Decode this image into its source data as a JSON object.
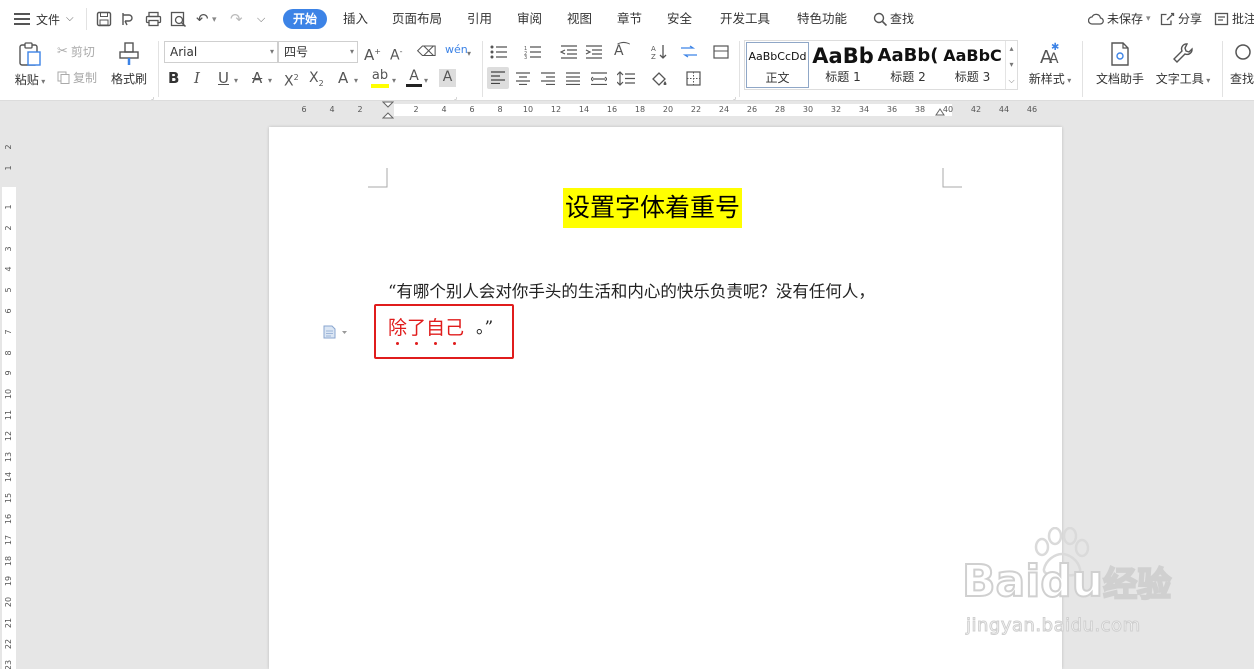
{
  "menu": {
    "file_label": "文件",
    "tabs": [
      "开始",
      "插入",
      "页面布局",
      "引用",
      "审阅",
      "视图",
      "章节",
      "安全",
      "开发工具",
      "特色功能"
    ],
    "search_label": "查找",
    "unsaved_label": "未保存",
    "share_label": "分享",
    "comment_label": "批注"
  },
  "ribbon": {
    "paste_label": "粘贴",
    "cut_label": "剪切",
    "copy_label": "复制",
    "format_painter_label": "格式刷",
    "font_name": "Arial",
    "font_size": "四号",
    "styles": [
      {
        "sample": "AaBbCcDd",
        "name": "正文"
      },
      {
        "sample": "AaBb",
        "name": "标题 1"
      },
      {
        "sample": "AaBb(",
        "name": "标题 2"
      },
      {
        "sample": "AaBbC",
        "name": "标题 3"
      }
    ],
    "new_style_label": "新样式",
    "doc_helper_label": "文档助手",
    "text_tools_label": "文字工具",
    "find_label": "查找",
    "highlight_color": "#ffff00",
    "font_color": "#e01c1c"
  },
  "ruler": {
    "h_labels": [
      "6",
      "4",
      "2",
      "2",
      "4",
      "6",
      "8",
      "10",
      "12",
      "14",
      "16",
      "18",
      "20",
      "22",
      "24",
      "26",
      "28",
      "30",
      "32",
      "34",
      "36",
      "38",
      "40",
      "42",
      "44",
      "46"
    ],
    "v_labels": [
      "2",
      "1",
      "1",
      "2",
      "3",
      "4",
      "5",
      "6",
      "7",
      "8",
      "9",
      "10",
      "11",
      "12",
      "13",
      "14",
      "15",
      "16",
      "17",
      "18",
      "19",
      "20",
      "21",
      "22",
      "23"
    ]
  },
  "document": {
    "title": "设置字体着重号",
    "line1": "“有哪个别人会对你手头的生活和内心的快乐负责呢？没有任何人，",
    "emph_chars": [
      "除",
      "了",
      "自",
      "己"
    ],
    "line2_end": "。”"
  },
  "watermark": {
    "brand": "Baidu",
    "brand_cn": "经验",
    "url": "jingyan.baidu.com"
  },
  "colors": {
    "accent": "#3c83e6",
    "highlight": "#ffff00",
    "emphasis_red": "#e01c1c"
  }
}
